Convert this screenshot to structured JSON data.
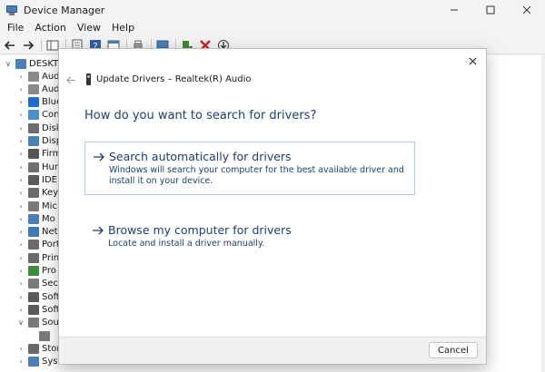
{
  "window": {
    "title": "Device Manager"
  },
  "menu": [
    "File",
    "Action",
    "View",
    "Help"
  ],
  "tree": {
    "root": "DESKTO",
    "items": [
      {
        "label": "Aud",
        "color": "#8a8a8a"
      },
      {
        "label": "Aud",
        "color": "#8a8a8a"
      },
      {
        "label": "Blue",
        "color": "#1f6fd1"
      },
      {
        "label": "Con",
        "color": "#4a8fcf"
      },
      {
        "label": "Disk",
        "color": "#6c6c6c"
      },
      {
        "label": "Disp",
        "color": "#4a7fb8"
      },
      {
        "label": "Firm",
        "color": "#555555"
      },
      {
        "label": "Hum",
        "color": "#707070"
      },
      {
        "label": "IDE",
        "color": "#5a5a5a"
      },
      {
        "label": "Keyb",
        "color": "#6a6a6a"
      },
      {
        "label": "Mic",
        "color": "#7a7a7a"
      },
      {
        "label": "Mo",
        "color": "#4a7fb8"
      },
      {
        "label": "Net",
        "color": "#3d7ab8"
      },
      {
        "label": "Port",
        "color": "#6a6a6a"
      },
      {
        "label": "Prin",
        "color": "#6a6a6a"
      },
      {
        "label": "Pro",
        "color": "#3c8a3c"
      },
      {
        "label": "Sec",
        "color": "#7a7a7a"
      },
      {
        "label": "Soft",
        "color": "#5a5a5a"
      },
      {
        "label": "Soft",
        "color": "#5a5a5a"
      },
      {
        "label": "Sou",
        "color": "#7a7a7a"
      },
      {
        "label": "",
        "color": "#7a7a7a"
      },
      {
        "label": "Stor",
        "color": "#6a6a6a"
      },
      {
        "label": "Syst",
        "color": "#4a7fb8"
      }
    ]
  },
  "dialog": {
    "title": "Update Drivers – Realtek(R) Audio",
    "question": "How do you want to search for drivers?",
    "option1": {
      "title": "Search automatically for drivers",
      "description": "Windows will search your computer for the best available driver and install it on your device."
    },
    "option2": {
      "title": "Browse my computer for drivers",
      "description": "Locate and install a driver manually."
    },
    "cancel_label": "Cancel"
  },
  "colors": {
    "accent_text": "#1e3f6e",
    "selected_border": "#a9d3e3"
  }
}
